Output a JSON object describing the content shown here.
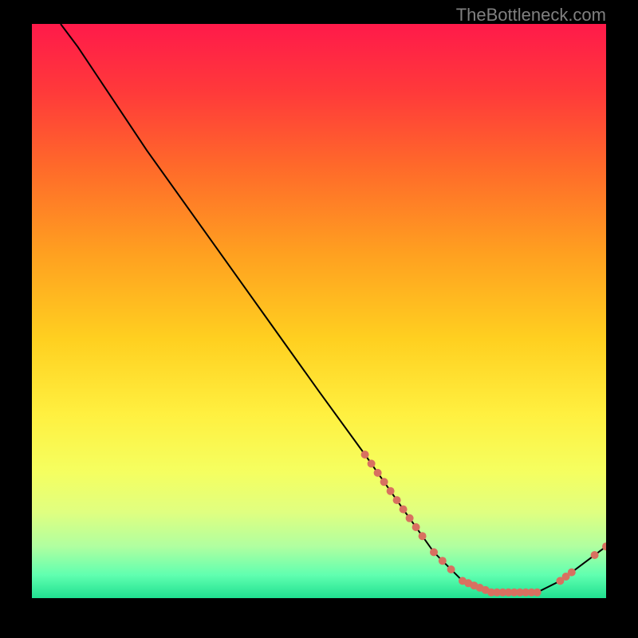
{
  "watermark": "TheBottleneck.com",
  "chart_data": {
    "type": "line",
    "title": "",
    "xlabel": "",
    "ylabel": "",
    "xlim": [
      0,
      100
    ],
    "ylim": [
      0,
      100
    ],
    "background_gradient": {
      "stops": [
        {
          "pos": 0,
          "color": "#ff1a4a"
        },
        {
          "pos": 12,
          "color": "#ff3a3a"
        },
        {
          "pos": 25,
          "color": "#ff6a2a"
        },
        {
          "pos": 40,
          "color": "#ffa020"
        },
        {
          "pos": 55,
          "color": "#ffd020"
        },
        {
          "pos": 68,
          "color": "#fff040"
        },
        {
          "pos": 78,
          "color": "#f5ff60"
        },
        {
          "pos": 85,
          "color": "#e0ff80"
        },
        {
          "pos": 91,
          "color": "#b0ffa0"
        },
        {
          "pos": 96,
          "color": "#60ffb0"
        },
        {
          "pos": 100,
          "color": "#20e090"
        }
      ]
    },
    "curve": [
      {
        "x": 5,
        "y": 100
      },
      {
        "x": 8,
        "y": 96
      },
      {
        "x": 12,
        "y": 90
      },
      {
        "x": 20,
        "y": 78
      },
      {
        "x": 30,
        "y": 64
      },
      {
        "x": 40,
        "y": 50
      },
      {
        "x": 50,
        "y": 36
      },
      {
        "x": 58,
        "y": 25
      },
      {
        "x": 65,
        "y": 15
      },
      {
        "x": 70,
        "y": 8
      },
      {
        "x": 75,
        "y": 3
      },
      {
        "x": 80,
        "y": 1
      },
      {
        "x": 85,
        "y": 1
      },
      {
        "x": 88,
        "y": 1
      },
      {
        "x": 92,
        "y": 3
      },
      {
        "x": 96,
        "y": 6
      },
      {
        "x": 100,
        "y": 9
      }
    ],
    "marker_clusters": [
      {
        "x_start": 58,
        "x_end": 68,
        "y_start": 25,
        "y_end": 10,
        "count": 10,
        "color": "#d87060"
      },
      {
        "x_start": 70,
        "x_end": 73,
        "y_start": 8,
        "y_end": 5,
        "count": 3,
        "color": "#d87060"
      },
      {
        "x_start": 75,
        "x_end": 88,
        "y_start": 2,
        "y_end": 1,
        "count": 14,
        "color": "#d87060"
      },
      {
        "x_start": 92,
        "x_end": 94,
        "y_start": 3,
        "y_end": 4,
        "count": 3,
        "color": "#d87060"
      },
      {
        "x_start": 98,
        "x_end": 100,
        "y_start": 7,
        "y_end": 9,
        "count": 2,
        "color": "#d87060"
      }
    ]
  }
}
